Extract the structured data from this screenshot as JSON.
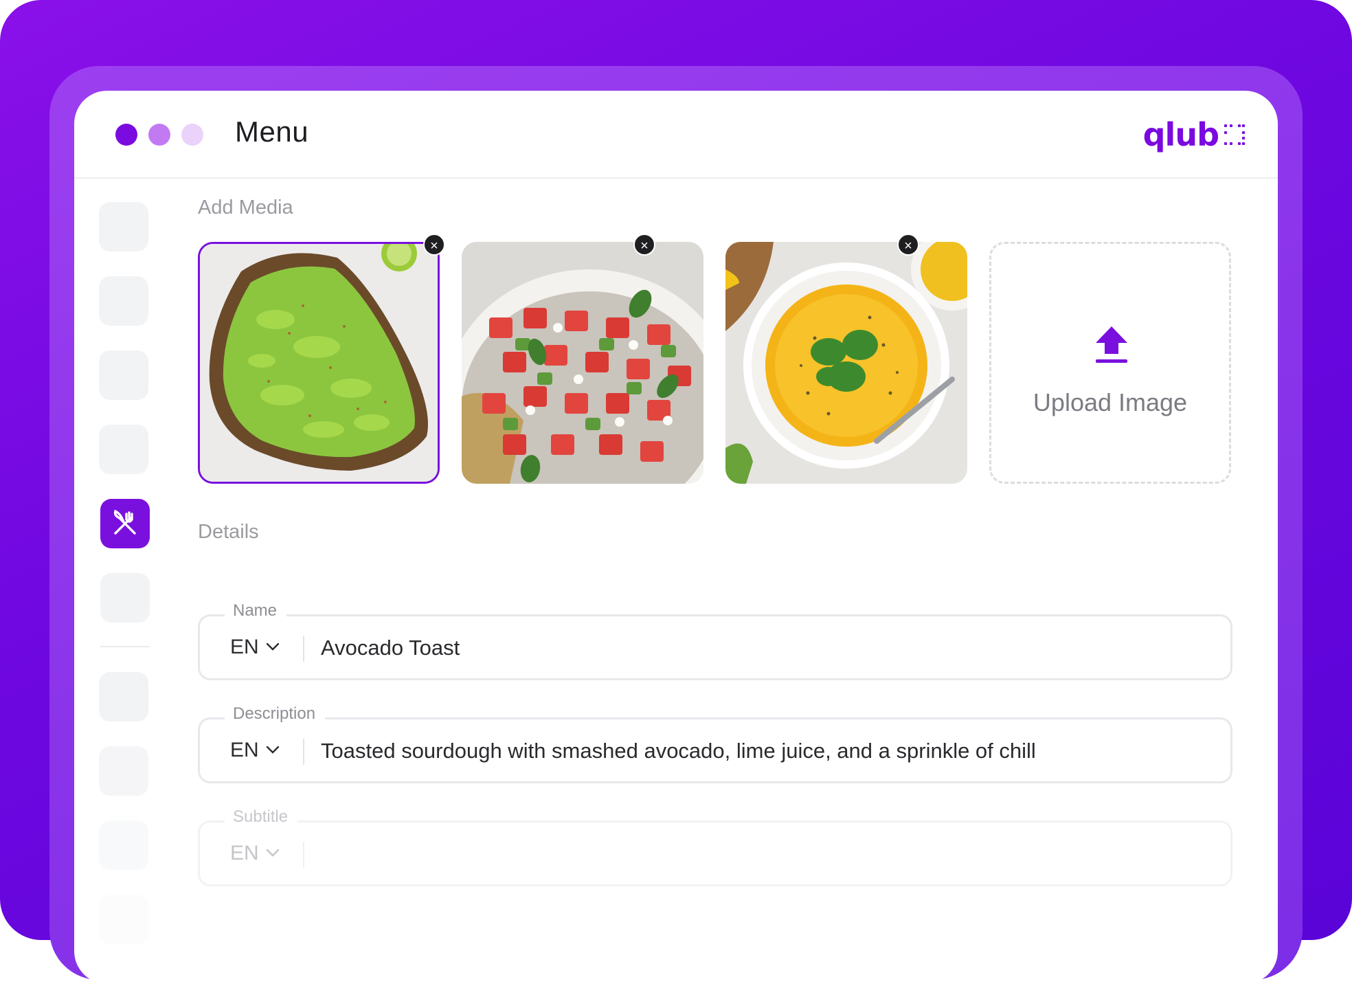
{
  "window": {
    "title": "Menu",
    "brand": "qlub",
    "accent": "#7a10de"
  },
  "sidebar": {
    "active_item_icon": "fork-knife-icon"
  },
  "media": {
    "section_label": "Add Media",
    "images": [
      {
        "alt": "avocado toast",
        "selected": true
      },
      {
        "alt": "watermelon salad",
        "selected": false
      },
      {
        "alt": "yellow soup",
        "selected": false
      }
    ],
    "remove_glyph": "×",
    "upload_label": "Upload Image"
  },
  "details": {
    "section_label": "Details",
    "fields": {
      "name": {
        "legend": "Name",
        "lang": "EN",
        "value": "Avocado Toast"
      },
      "description": {
        "legend": "Description",
        "lang": "EN",
        "value": "Toasted sourdough with smashed avocado, lime juice, and a sprinkle of chill"
      },
      "subtitle": {
        "legend": "Subtitle",
        "lang": "EN",
        "value": ""
      }
    }
  }
}
